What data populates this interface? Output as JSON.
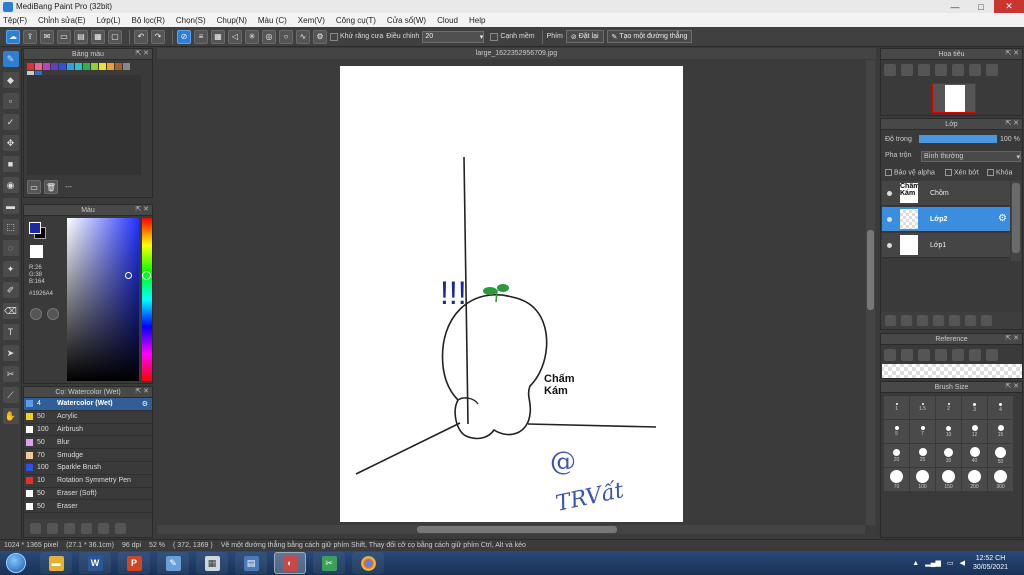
{
  "window": {
    "title": "MediBang Paint Pro (32bit)",
    "minimize": "—",
    "maximize": "□",
    "close": "✕"
  },
  "menu": [
    "Tệp(F)",
    "Chỉnh sửa(E)",
    "Lớp(L)",
    "Bộ lọc(R)",
    "Chọn(S)",
    "Chụp(N)",
    "Màu (C)",
    "Xem(V)",
    "Công cụ(T)",
    "Cửa sổ(W)",
    "Cloud",
    "Help"
  ],
  "toolbar": {
    "antialias_label": "Khử răng cưa",
    "correction_label": "Điều chỉnh",
    "correction_value": "20",
    "soft_edge_label": "Cạnh mềm",
    "key_label": "Phím",
    "reset_label": "Đặt lại",
    "create_line_label": "Tạo một đường thẳng"
  },
  "panels": {
    "palette_title": "Bảng màu",
    "palette_footer": "---",
    "color_title": "Màu",
    "color_r": "R:26",
    "color_g": "G:38",
    "color_b": "B:164",
    "color_hex": "#1926A4",
    "brush_title": "Cọ: Watercolor (Wet)",
    "navigator_title": "Hoa tiêu",
    "layer_title": "Lớp",
    "opacity_label": "Độ trong",
    "opacity_value": "100 %",
    "blend_label": "Pha trộn",
    "blend_value": "Bình thường",
    "protect_alpha": "Bảo vệ alpha",
    "clipping": "Xén bớt",
    "lock": "Khóa",
    "reference_title": "Reference",
    "brushsize_title": "Brush Size"
  },
  "brushes": [
    {
      "size": "4",
      "name": "Watercolor (Wet)",
      "color": "#5aa0e8",
      "active": true
    },
    {
      "size": "50",
      "name": "Acrylic",
      "color": "#f0d020"
    },
    {
      "size": "100",
      "name": "Airbrush",
      "color": "#ffffff"
    },
    {
      "size": "50",
      "name": "Blur",
      "color": "#e0a0f0"
    },
    {
      "size": "70",
      "name": "Smudge",
      "color": "#f0c8a0"
    },
    {
      "size": "100",
      "name": "Sparkle Brush",
      "color": "#3050e0"
    },
    {
      "size": "10",
      "name": "Rotation Symmetry Pen",
      "color": "#e03030"
    },
    {
      "size": "50",
      "name": "Eraser (Soft)",
      "color": "#ffffff"
    },
    {
      "size": "50",
      "name": "Eraser",
      "color": "#ffffff"
    }
  ],
  "layers": [
    {
      "name": "Chồm",
      "thumb_text": "Chấm Kám",
      "active": false
    },
    {
      "name": "Lớp2",
      "thumb_text": "",
      "active": true
    },
    {
      "name": "Lớp1",
      "thumb_text": "",
      "active": false
    }
  ],
  "canvas": {
    "tab_title": "large_1622352956709.jpg",
    "caption_line1": "Chấm",
    "caption_line2": "Kám",
    "mark": "!!!",
    "signature_at": "@",
    "signature": "TRVất"
  },
  "brush_sizes": [
    "1",
    "1.5",
    "2",
    "3",
    "4",
    "5",
    "7",
    "10",
    "12",
    "15",
    "20",
    "25",
    "30",
    "40",
    "50",
    "70",
    "100",
    "150",
    "200",
    "300"
  ],
  "status": {
    "size": "1024 * 1365 pixel",
    "physical": "(27.1 * 36.1cm)",
    "dpi": "96 dpi",
    "zoom": "52 %",
    "coords": "( 372, 1369 )",
    "hint": "Vẽ một đường thẳng bằng cách giữ phím Shift, Thay đổi cỡ cọ bằng cách giữ phím Ctrl, Alt và kéo"
  },
  "taskbar": {
    "time": "12:52 CH",
    "date": "30/05/2021"
  },
  "colors": {
    "accent": "#2d7fd6",
    "stroke_blue": "#1926A4",
    "sprout_green": "#2c9a3c"
  }
}
